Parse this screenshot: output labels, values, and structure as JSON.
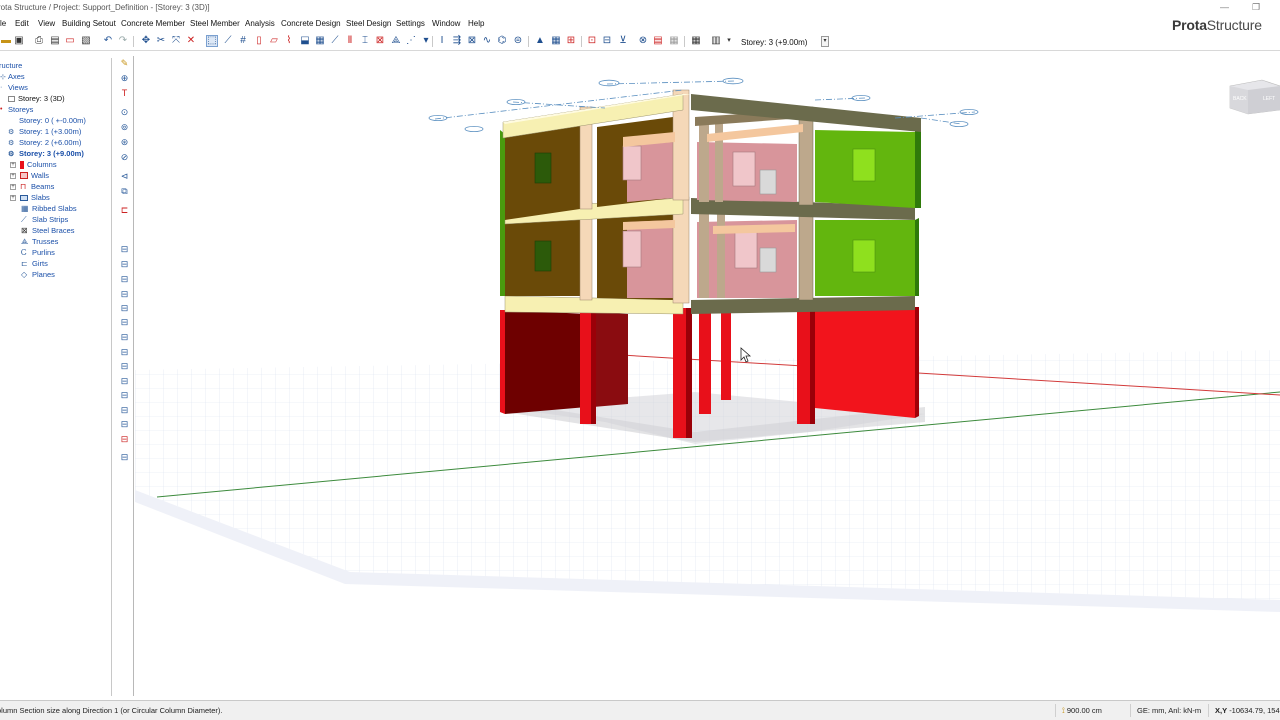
{
  "window": {
    "title": "rota Structure / Project: Support_Definition - [Storey: 3 (3D)]",
    "minimize_icon": "minimize-icon",
    "restore_icon": "restore-icon"
  },
  "menu": {
    "items": [
      "le",
      "Edit",
      "View",
      "Building Setout",
      "Concrete Member",
      "Steel Member",
      "Analysis",
      "Concrete Design",
      "Steel Design",
      "Settings",
      "Window",
      "Help"
    ],
    "brand_bold": "Prota",
    "brand_rest": "Structure"
  },
  "toolbar": {
    "storey_selector": "Storey: 3 (+9.00m)",
    "dropdown_arrow": "▾"
  },
  "tree": {
    "items": [
      {
        "label": "ructure",
        "icon": "structure-icon"
      },
      {
        "label": "Axes",
        "icon": "axes-icon"
      },
      {
        "label": "Views",
        "icon": "views-icon"
      },
      {
        "label": "Storey: 3 (3D)",
        "icon": "view-3d-icon"
      },
      {
        "label": "Storeys",
        "icon": "storeys-icon"
      },
      {
        "label": "Storey: 0 ( +-0.00m)",
        "icon": "storey-icon"
      },
      {
        "label": "Storey: 1 (+3.00m)",
        "icon": "storey-icon"
      },
      {
        "label": "Storey: 2 (+6.00m)",
        "icon": "storey-icon"
      },
      {
        "label": "Storey: 3 (+9.00m)",
        "icon": "storey-icon"
      },
      {
        "label": "Columns",
        "icon": "columns-icon"
      },
      {
        "label": "Walls",
        "icon": "walls-icon"
      },
      {
        "label": "Beams",
        "icon": "beams-icon"
      },
      {
        "label": "Slabs",
        "icon": "slabs-icon"
      },
      {
        "label": "Ribbed Slabs",
        "icon": "ribbed-slabs-icon"
      },
      {
        "label": "Slab Strips",
        "icon": "slab-strips-icon"
      },
      {
        "label": "Steel Braces",
        "icon": "steel-braces-icon"
      },
      {
        "label": "Trusses",
        "icon": "trusses-icon"
      },
      {
        "label": "Purlins",
        "icon": "purlins-icon"
      },
      {
        "label": "Girts",
        "icon": "girts-icon"
      },
      {
        "label": "Planes",
        "icon": "planes-icon"
      }
    ]
  },
  "viewcube": {
    "face_left": "BACK",
    "face_right": "LEFT"
  },
  "status": {
    "message": "olumn Section size along Direction 1 (or Circular Column Diameter).",
    "dimension": "900.00 cm",
    "units": "GE: mm,  Anl: kN-m",
    "coords_label": "X,Y",
    "coords": "-10634.79, 154"
  },
  "colors": {
    "column": "#e8101a",
    "wall_red": "#f2141c",
    "wall_dark": "#6e0000",
    "wall_green": "#63b60e",
    "wall_olive": "#6a4a08",
    "beam_yellow": "#f7f0b2",
    "beam_olive": "#6b6b4c",
    "pink_wall": "#d8959b",
    "axis_red": "#d23a3a",
    "axis_green": "#3c8a3c",
    "accent_blue": "#1f4f8f"
  }
}
